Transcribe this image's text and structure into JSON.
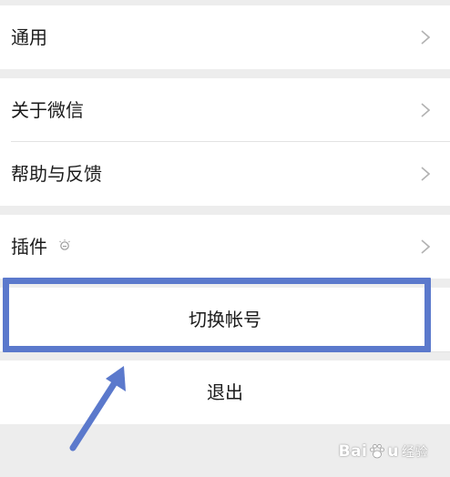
{
  "settings": {
    "items": [
      {
        "label": "通用"
      },
      {
        "label": "关于微信"
      },
      {
        "label": "帮助与反馈"
      },
      {
        "label": "插件"
      }
    ],
    "switch_account": "切换帐号",
    "logout": "退出"
  },
  "icons": {
    "chevron": "chevron-right-icon",
    "plugin_badge": "lightbulb-icon",
    "arrow": "annotation-arrow-icon"
  },
  "watermark": {
    "brand_left": "Bai",
    "brand_right": "u",
    "suffix": "经验"
  },
  "colors": {
    "background": "#ededed",
    "cell": "#ffffff",
    "highlight": "#5b79cc"
  }
}
